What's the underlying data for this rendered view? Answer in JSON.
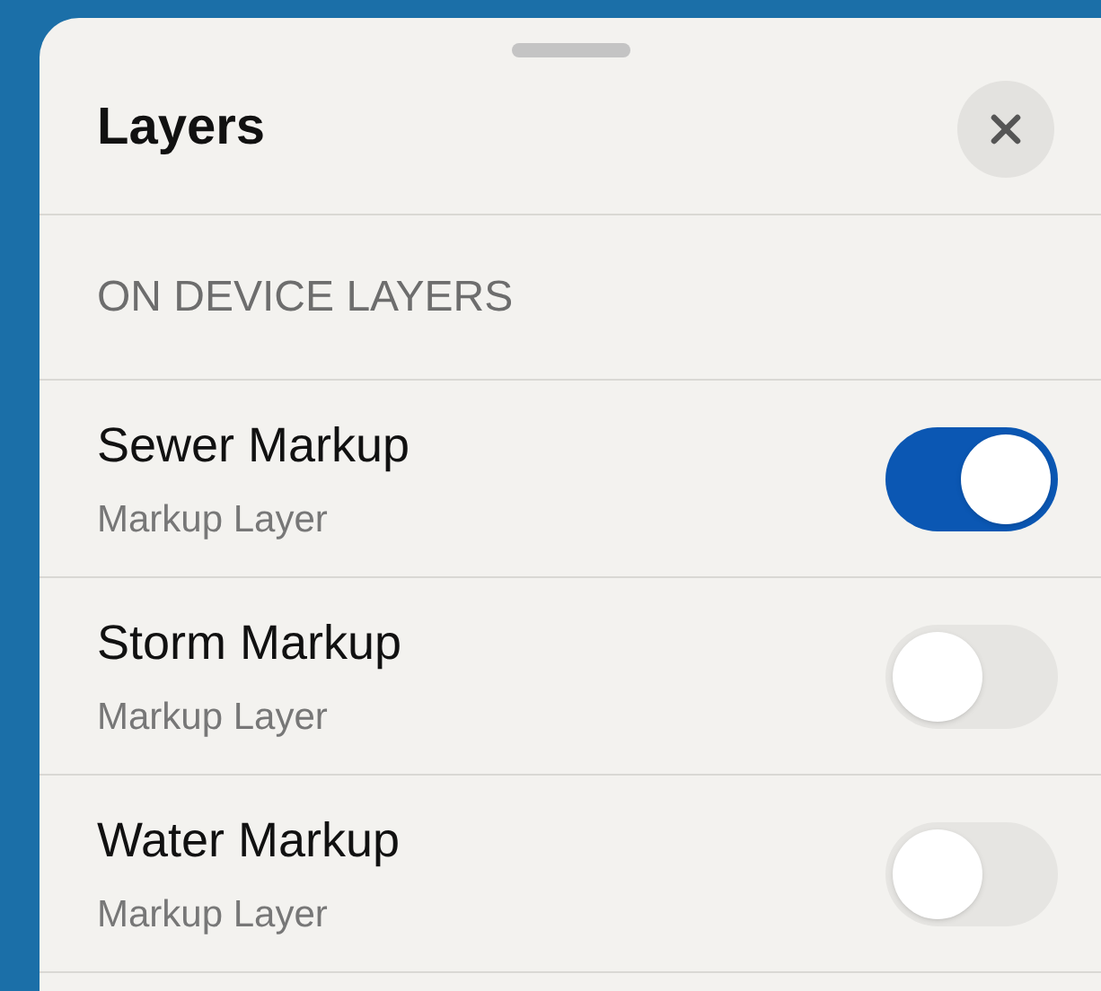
{
  "sheet": {
    "title": "Layers"
  },
  "section": {
    "heading": "ON DEVICE LAYERS"
  },
  "layers": [
    {
      "name": "Sewer Markup",
      "subtitle": "Markup Layer",
      "on": true
    },
    {
      "name": "Storm Markup",
      "subtitle": "Markup Layer",
      "on": false
    },
    {
      "name": "Water Markup",
      "subtitle": "Markup Layer",
      "on": false
    }
  ]
}
